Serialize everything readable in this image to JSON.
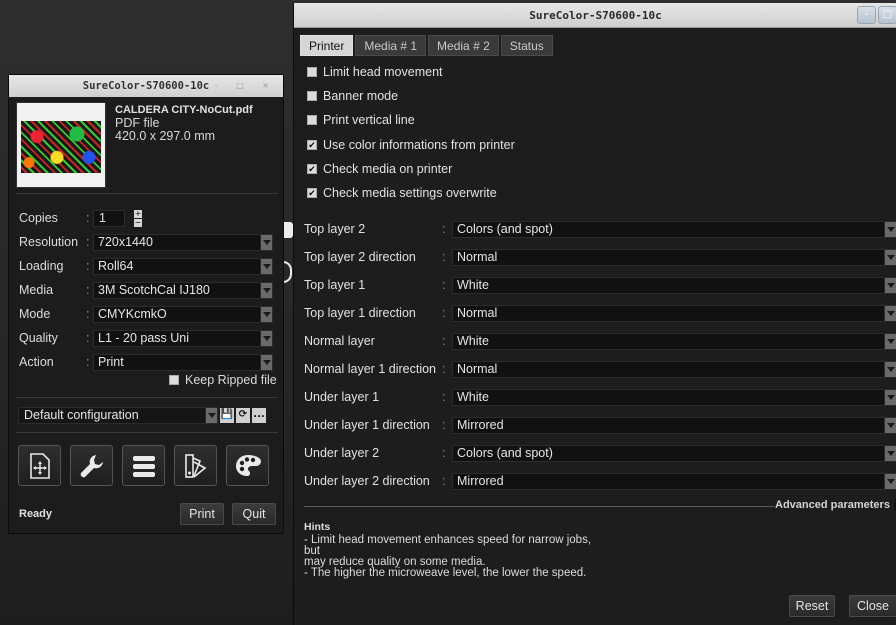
{
  "right_window": {
    "title": "SureColor-S70600-10c",
    "tabs": [
      {
        "label": "Printer",
        "active": true
      },
      {
        "label": "Media # 1",
        "active": false
      },
      {
        "label": "Media # 2",
        "active": false
      },
      {
        "label": "Status",
        "active": false
      }
    ],
    "checkboxes": [
      {
        "label": "Limit head movement",
        "checked": false
      },
      {
        "label": "Banner mode",
        "checked": false
      },
      {
        "label": "Print vertical line",
        "checked": false
      },
      {
        "label": "Use color informations from printer",
        "checked": true
      },
      {
        "label": "Check media on printer",
        "checked": true
      },
      {
        "label": "Check media settings overwrite",
        "checked": true
      }
    ],
    "layers": [
      {
        "label": "Top layer 2",
        "value": "Colors (and spot)"
      },
      {
        "label": "Top layer 2 direction",
        "value": "Normal"
      },
      {
        "label": "Top layer 1",
        "value": "White"
      },
      {
        "label": "Top layer 1 direction",
        "value": "Normal"
      },
      {
        "label": "Normal layer",
        "value": "White"
      },
      {
        "label": "Normal layer 1 direction",
        "value": "Normal"
      },
      {
        "label": "Under layer 1",
        "value": "White"
      },
      {
        "label": "Under layer 1 direction",
        "value": "Mirrored"
      },
      {
        "label": "Under layer 2",
        "value": "Colors (and spot)"
      },
      {
        "label": "Under layer 2 direction",
        "value": "Mirrored"
      }
    ],
    "colon": ":",
    "advanced_label": "Advanced parameters",
    "advanced_plus": "+",
    "hints": {
      "title": "Hints",
      "lines": [
        "- Limit head movement enhances speed for narrow jobs,",
        "but",
        "may reduce quality on some media.",
        "- The higher the microweave level, the lower the speed."
      ]
    },
    "reset_label": "Reset",
    "close_label": "Close",
    "wm_minimize": "-",
    "wm_maximize": "□"
  },
  "left_window": {
    "title": "SureColor-S70600-10c",
    "wm_glyphs": "- □ ×",
    "file": {
      "name": "CALDERA CITY-NoCut.pdf",
      "type": "PDF file",
      "size": "420.0 x 297.0 mm"
    },
    "copies": {
      "label": "Copies",
      "value": "1"
    },
    "settings": [
      {
        "label": "Resolution",
        "value": "720x1440"
      },
      {
        "label": "Loading",
        "value": "Roll64"
      },
      {
        "label": "Media",
        "value": "3M ScotchCal  IJ180"
      },
      {
        "label": "Mode",
        "value": "CMYKcmkO"
      },
      {
        "label": "Quality",
        "value": "L1 - 20 pass Uni"
      },
      {
        "label": "Action",
        "value": "Print"
      }
    ],
    "keep_ripped": {
      "label": "Keep Ripped file",
      "checked": false
    },
    "configuration": "Default configuration",
    "config_buttons": [
      "💾",
      "⟳",
      "..."
    ],
    "status": "Ready",
    "print_label": "Print",
    "quit_label": "Quit"
  }
}
